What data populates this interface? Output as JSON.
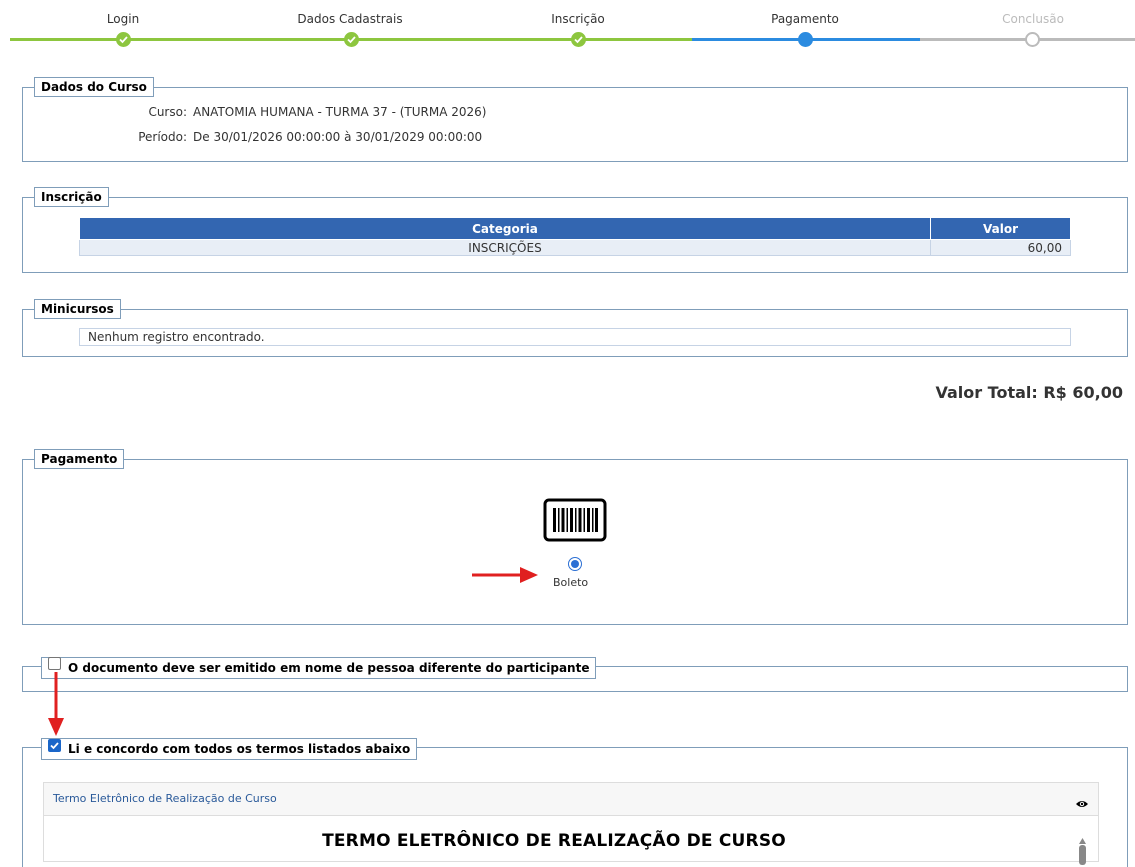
{
  "steps": [
    {
      "label": "Login",
      "state": "done"
    },
    {
      "label": "Dados Cadastrais",
      "state": "done"
    },
    {
      "label": "Inscrição",
      "state": "done"
    },
    {
      "label": "Pagamento",
      "state": "current"
    },
    {
      "label": "Conclusão",
      "state": "pending"
    }
  ],
  "curso": {
    "legend": "Dados do Curso",
    "curso_label": "Curso:",
    "curso_value": "ANATOMIA HUMANA - TURMA 37 - (TURMA 2026)",
    "periodo_label": "Período:",
    "periodo_value": "De 30/01/2026 00:00:00 à 30/01/2029 00:00:00"
  },
  "inscricao": {
    "legend": "Inscrição",
    "col_categoria": "Categoria",
    "col_valor": "Valor",
    "rows": [
      {
        "categoria": "INSCRIÇÕES",
        "valor": "60,00"
      }
    ]
  },
  "minicursos": {
    "legend": "Minicursos",
    "empty": "Nenhum registro encontrado."
  },
  "total": "Valor Total: R$ 60,00",
  "pagamento": {
    "legend": "Pagamento",
    "option_label": "Boleto",
    "selected": true,
    "icon": "barcode-icon"
  },
  "documento": {
    "label": "O documento deve ser emitido em nome de pessoa diferente do participante",
    "checked": false
  },
  "termos": {
    "label": "Li e concordo com todos os termos listados abaixo",
    "checked": true,
    "panel_title": "Termo Eletrônico de Realização de Curso",
    "heading": "TERMO ELETRÔNICO DE REALIZAÇÃO DE CURSO",
    "icon": "eye-icon"
  },
  "colors": {
    "done": "#8dc63f",
    "current": "#2b8be0",
    "pending": "#bbbbbb",
    "table_header": "#3366b1",
    "annotation_arrow": "#e02020"
  }
}
